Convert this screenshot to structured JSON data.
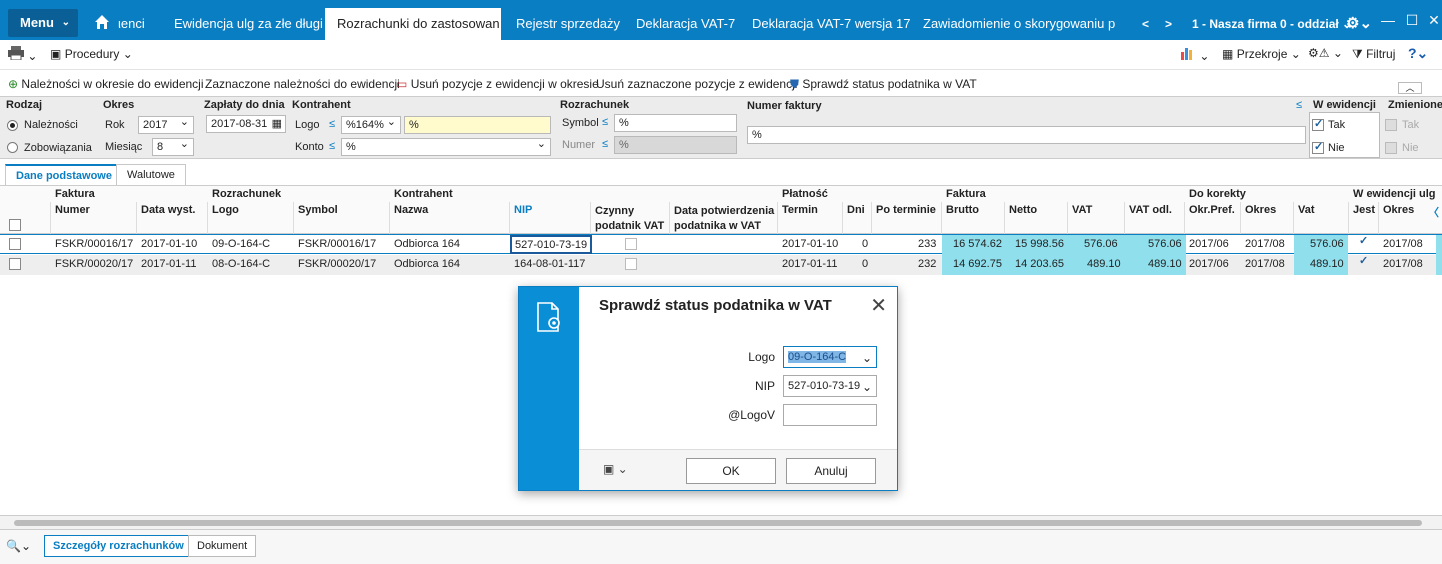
{
  "topbar": {
    "menu_label": "Menu",
    "tabs": [
      "ιenci",
      "Ewidencja ulg za złe długi",
      "Rozrachunki do zastosowan",
      "Rejestr sprzedaży",
      "Deklaracja VAT-7",
      "Deklaracja VAT-7 wersja 17",
      "Zawiadomienie o skorygowaniu pod"
    ],
    "company": "1 - Nasza firma 0 - oddział"
  },
  "toolbar1": {
    "procedury": "Procedury",
    "przekroje": "Przekroje",
    "filtruj": "Filtruj"
  },
  "toolbar2": {
    "items": [
      "Należności w okresie do ewidencji",
      "Zaznaczone należności do ewidencji",
      "Usuń pozycje z ewidencji w okresie",
      "Usuń zaznaczone pozycje z ewidencji",
      "Sprawdź status podatnika w VAT"
    ]
  },
  "filters": {
    "rodzaj_label": "Rodzaj",
    "naleznosci": "Należności",
    "zobowiazania": "Zobowiązania",
    "okres_label": "Okres",
    "rok_label": "Rok",
    "rok_value": "2017",
    "miesiac_label": "Miesiąc",
    "miesiac_value": "8",
    "zaplaty_label": "Zapłaty do dnia",
    "zaplaty_value": "2017-08-31",
    "kontrahent_label": "Kontrahent",
    "logo_label": "Logo",
    "logo_value": "%164%",
    "logo_text": "%",
    "konto_label": "Konto",
    "konto_value": "%",
    "rozrachunek_label": "Rozrachunek",
    "symbol_label": "Symbol",
    "symbol_value": "%",
    "numer_label": "Numer",
    "numer_value": "%",
    "numer_faktury_label": "Numer faktury",
    "numer_faktury_value": "%",
    "w_ewidencji_label": "W ewidencji",
    "tak": "Tak",
    "nie": "Nie",
    "zmienione_label": "Zmienione",
    "zm_tak": "Tak",
    "zm_nie": "Nie",
    "le": "≤"
  },
  "tabs": [
    "Dane podstawowe",
    "Walutowe"
  ],
  "grid": {
    "groups": [
      "Faktura",
      "Rozrachunek",
      "Kontrahent",
      "Płatność",
      "Faktura",
      "Do korekty",
      "W ewidencji ulg"
    ],
    "columns": [
      "Numer",
      "Data wyst.",
      "Logo",
      "Symbol",
      "Nazwa",
      "NIP",
      "Czynny\npodatnik VAT",
      "Data potwierdzenia\npodatnika w VAT",
      "Termin",
      "Dni",
      "Po terminie",
      "Brutto",
      "Netto",
      "VAT",
      "VAT odl.",
      "Okr.Pref.",
      "Okres",
      "Vat",
      "Jest",
      "Okres"
    ],
    "rows": [
      {
        "numer": "FSKR/00016/17",
        "data": "2017-01-10",
        "logo": "09-O-164-C",
        "symbol": "FSKR/00016/17",
        "nazwa": "Odbiorca 164",
        "nip": "527-010-73-19",
        "termin": "2017-01-10",
        "dni": "0",
        "po_terminie": "233",
        "brutto": "16 574.62",
        "netto": "15 998.56",
        "vat": "576.06",
        "vat_odl": "576.06",
        "okr_pref": "2017/06",
        "okres": "2017/08",
        "vat2": "576.06",
        "okres2": "2017/08"
      },
      {
        "numer": "FSKR/00020/17",
        "data": "2017-01-11",
        "logo": "08-O-164-C",
        "symbol": "FSKR/00020/17",
        "nazwa": "Odbiorca 164",
        "nip": "164-08-01-117",
        "termin": "2017-01-11",
        "dni": "0",
        "po_terminie": "232",
        "brutto": "14 692.75",
        "netto": "14 203.65",
        "vat": "489.10",
        "vat_odl": "489.10",
        "okr_pref": "2017/06",
        "okres": "2017/08",
        "vat2": "489.10",
        "okres2": "2017/08"
      }
    ]
  },
  "bottom": {
    "tabs": [
      "Szczegóły rozrachunków",
      "Dokument"
    ]
  },
  "dialog": {
    "title": "Sprawdź status podatnika w VAT",
    "logo_label": "Logo",
    "logo_value": "09-O-164-C",
    "nip_label": "NIP",
    "nip_value": "527-010-73-19",
    "logov_label": "@LogoV",
    "logov_value": "",
    "ok": "OK",
    "cancel": "Anuluj"
  },
  "colors": {
    "accent": "#0a7ec2",
    "highlight": "#90dfec"
  }
}
